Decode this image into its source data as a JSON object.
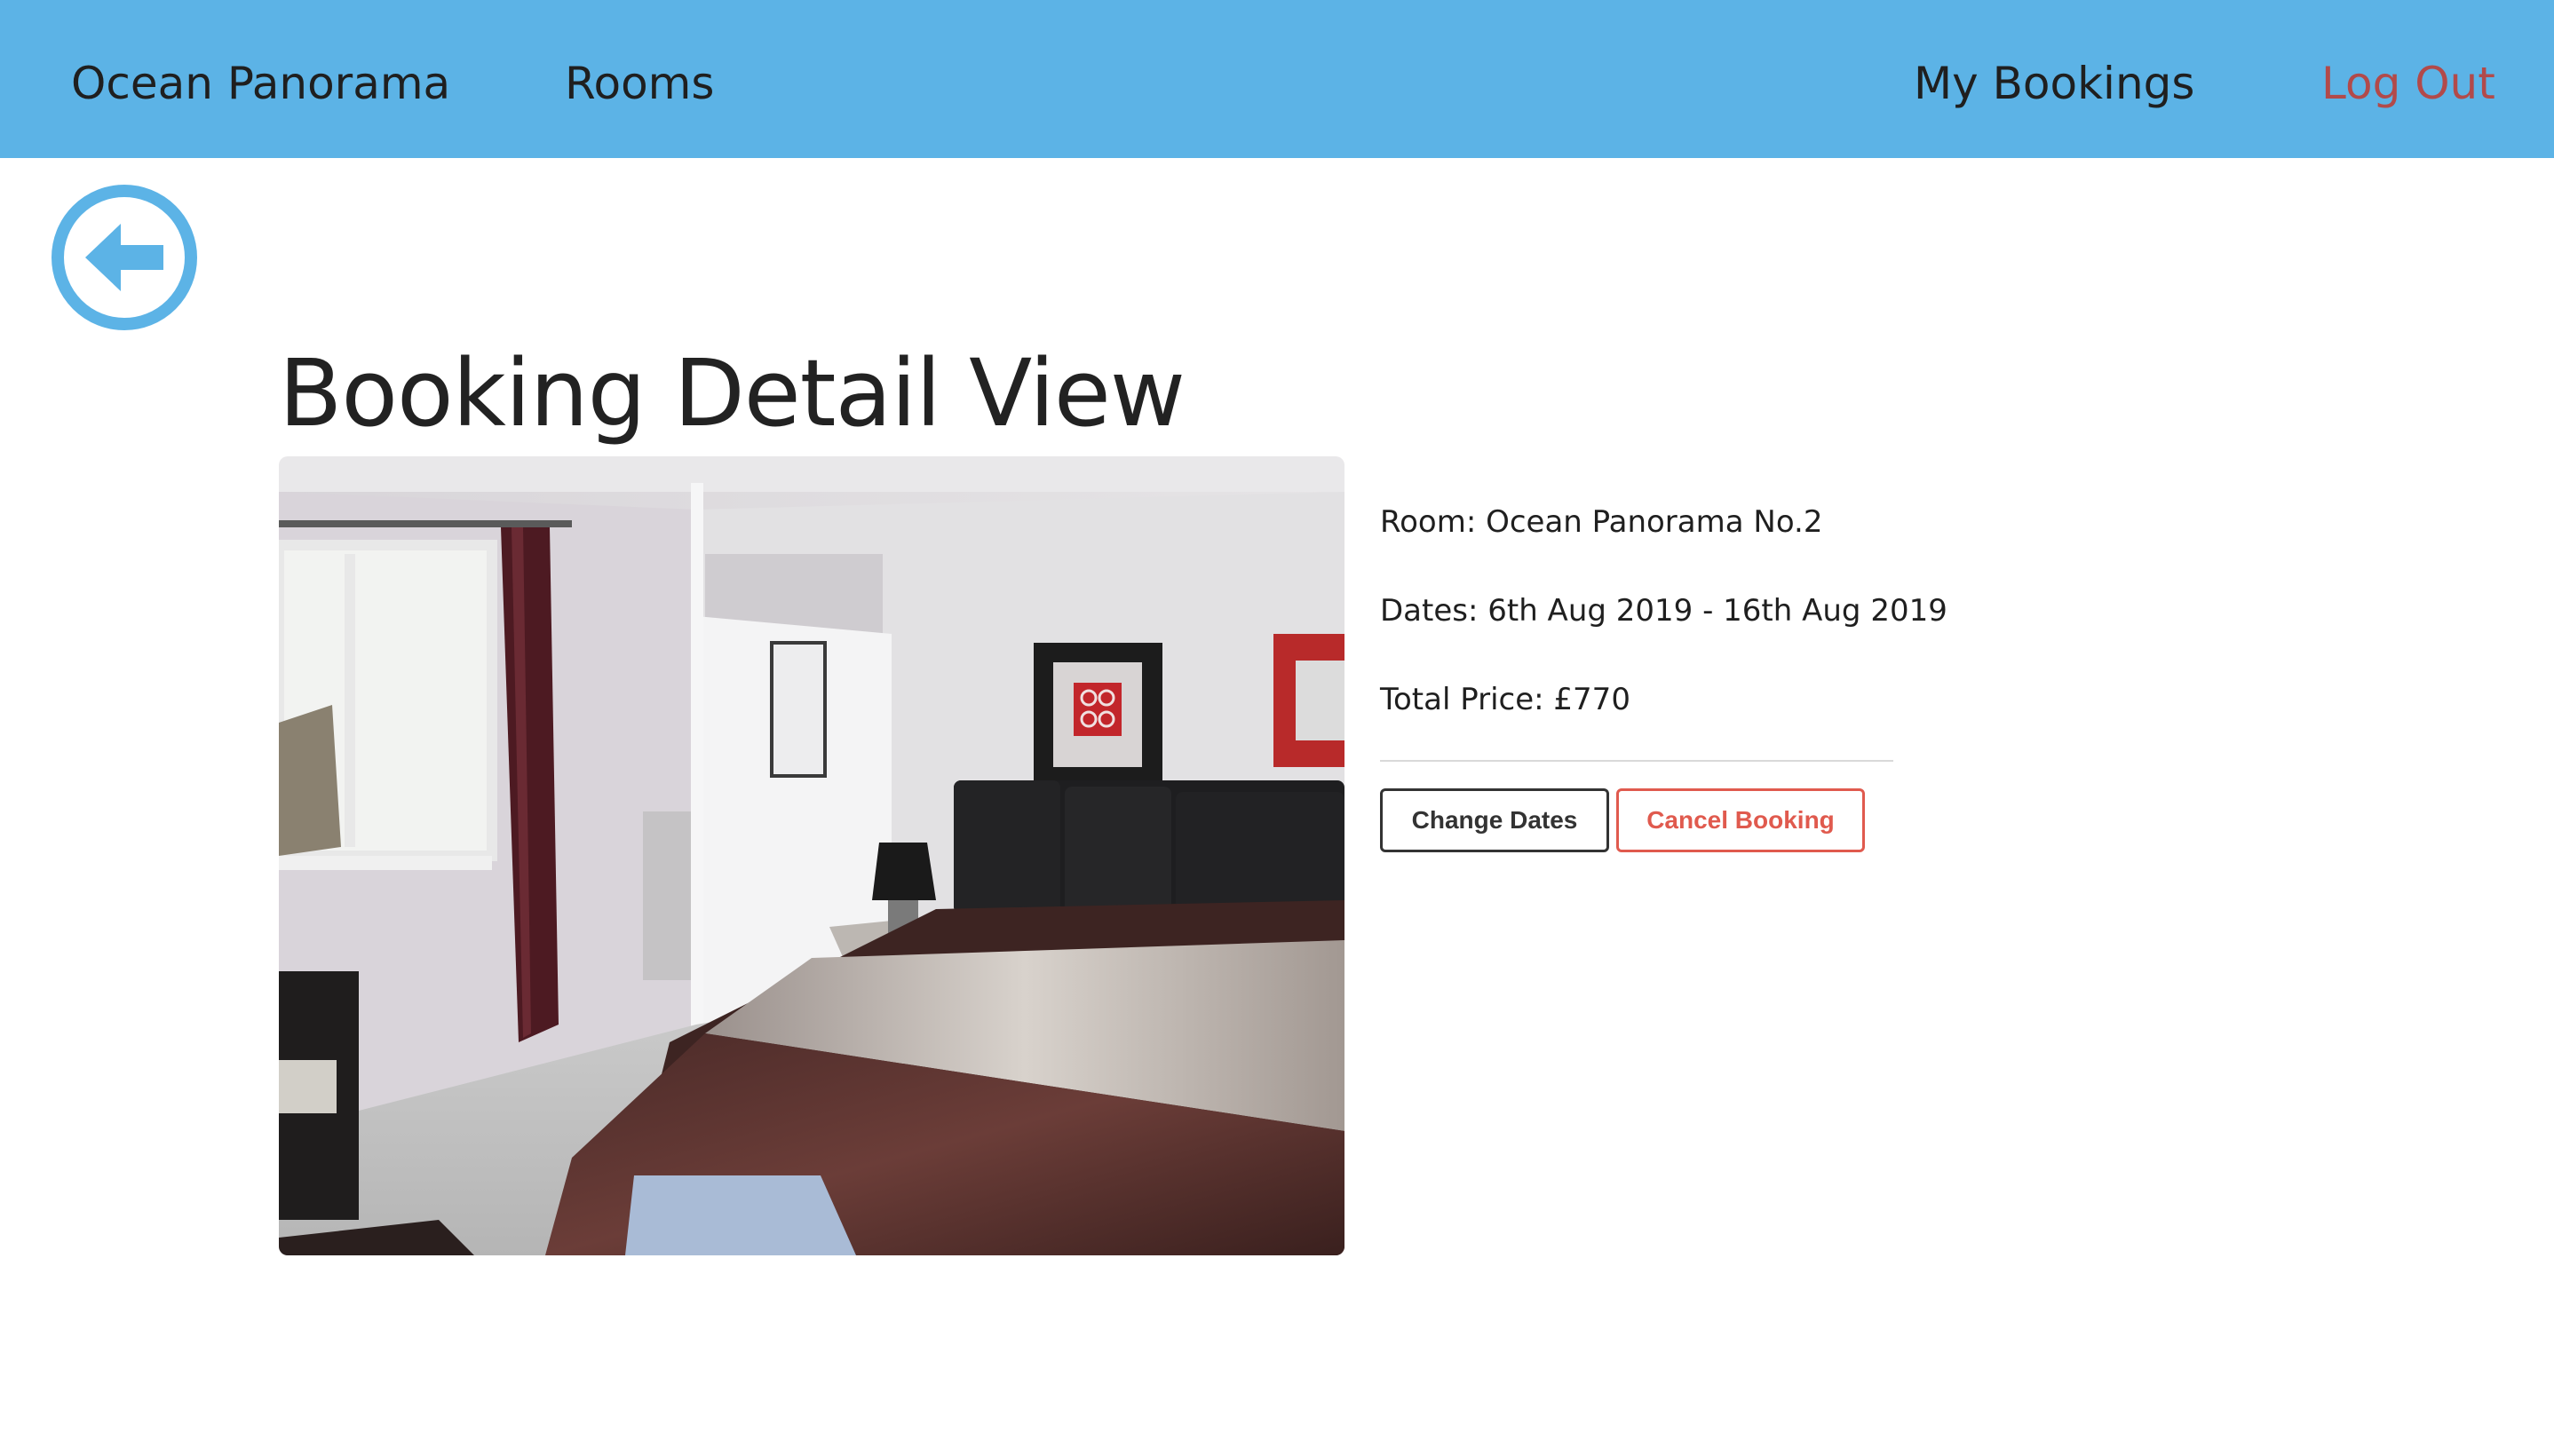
{
  "nav": {
    "brand": "Ocean Panorama",
    "rooms": "Rooms",
    "my_bookings": "My Bookings",
    "log_out": "Log Out"
  },
  "back_button": {
    "icon": "arrow-left-circle-icon"
  },
  "page": {
    "title": "Booking Detail View"
  },
  "booking": {
    "room": "Room: Ocean Panorama No.2",
    "dates": "Dates: 6th Aug 2019 - 16th Aug 2019",
    "total_price": "Total Price: £770"
  },
  "actions": {
    "change_dates": "Change Dates",
    "cancel_booking": "Cancel Booking"
  },
  "colors": {
    "navbar": "#5cb3e6",
    "logout": "#b24a4a",
    "cancel": "#e05a4e",
    "accent": "#5cb3e6"
  }
}
